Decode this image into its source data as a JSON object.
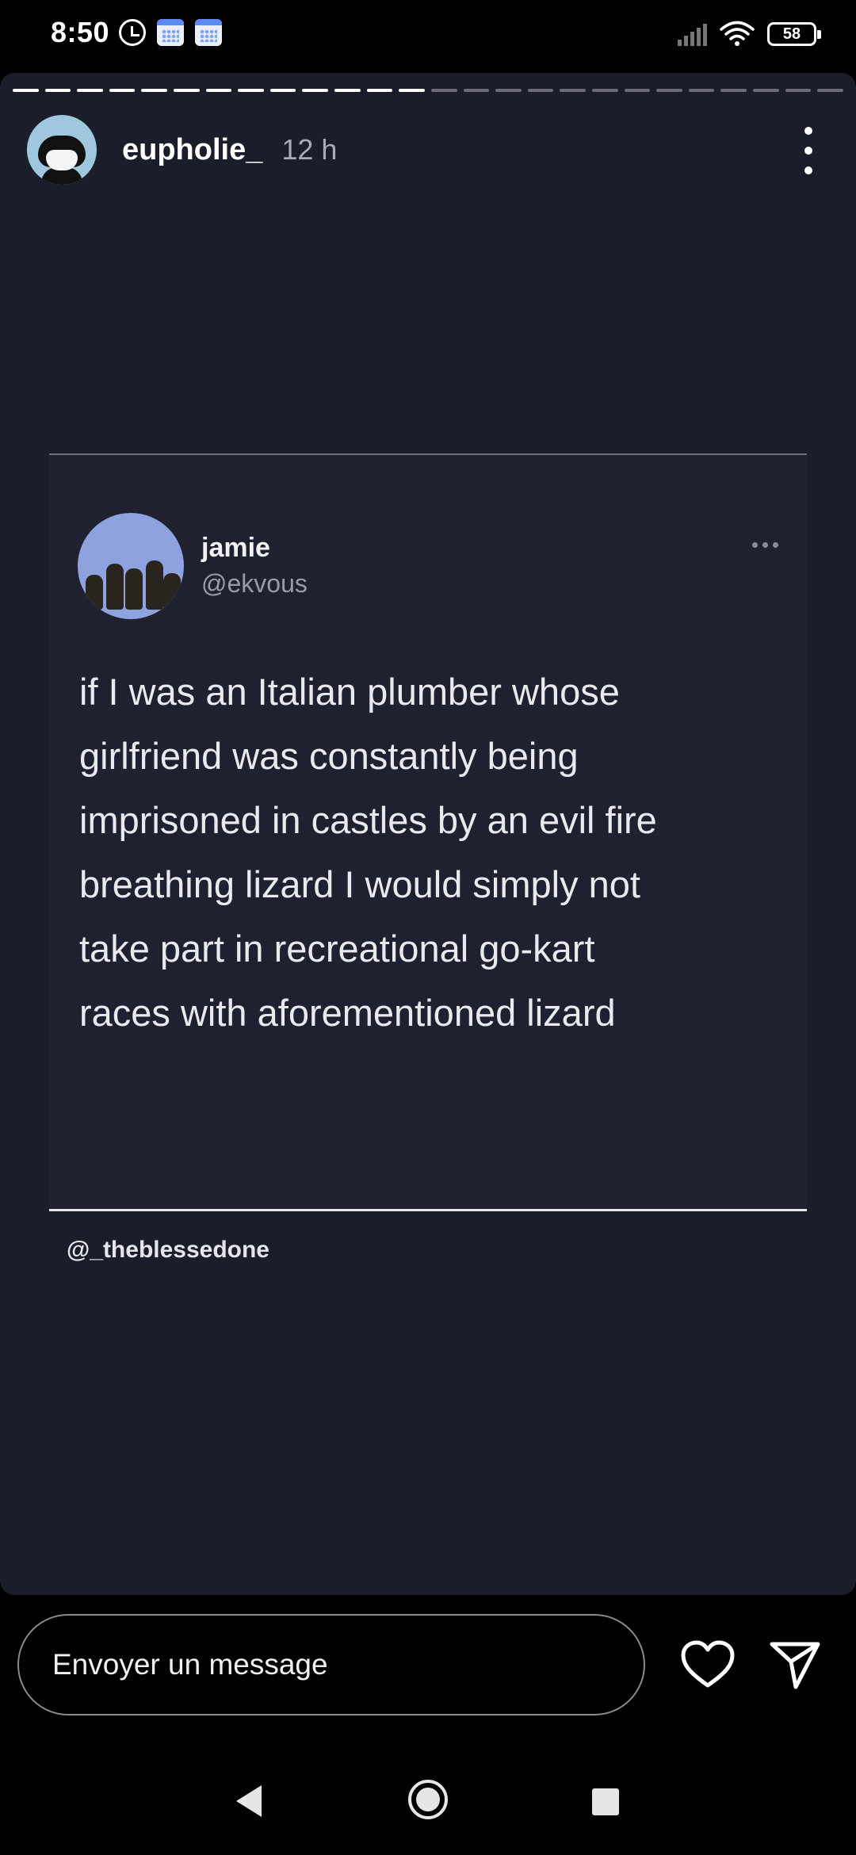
{
  "status_bar": {
    "time": "8:50",
    "battery": "58",
    "icons": [
      "alarm-icon",
      "calendar-icon",
      "calendar-icon",
      "signal-icon",
      "wifi-icon",
      "battery-icon"
    ]
  },
  "story": {
    "progress_segments": 26,
    "progress_completed": 13,
    "username": "eupholie_",
    "time_ago": "12 h",
    "background": "#1c1d2b"
  },
  "tweet": {
    "name": "jamie",
    "handle": "@ekvous",
    "lines": [
      "if I was an Italian plumber whose",
      "girlfriend was constantly being",
      "imprisoned in castles by an evil fire",
      "breathing lizard I would simply not",
      "take part in recreational go-kart",
      "races with aforementioned lizard"
    ]
  },
  "credit": "@_theblessedone",
  "reply": {
    "placeholder": "Envoyer un message"
  },
  "icons": {
    "like": "heart-icon",
    "share": "send-icon",
    "options": "more-vertical-icon"
  }
}
